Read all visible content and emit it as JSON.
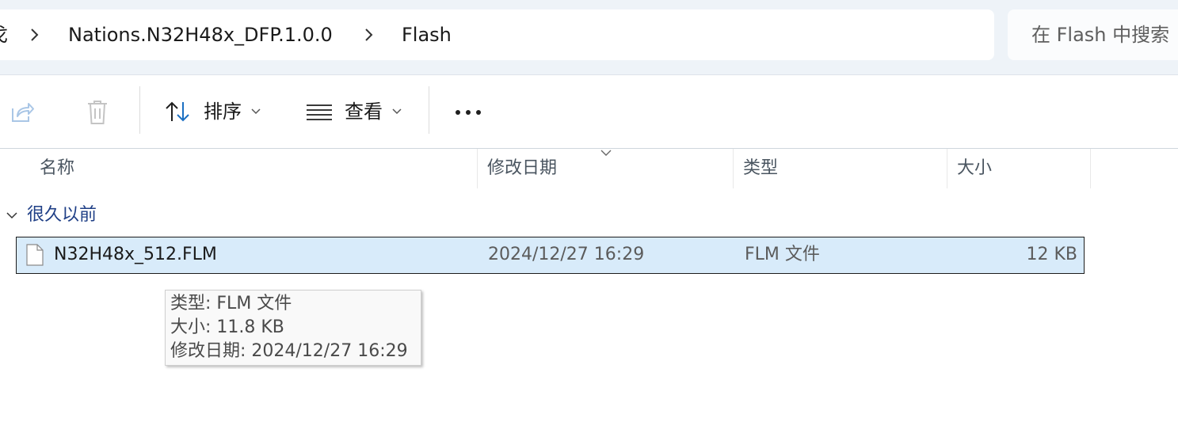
{
  "address_bar": {
    "crumbs": [
      "戈",
      "Nations.N32H48x_DFP.1.0.0",
      "Flash"
    ]
  },
  "search": {
    "placeholder": "在 Flash 中搜索"
  },
  "toolbar": {
    "share_icon": "share-icon",
    "delete_icon": "trash-icon",
    "sort_label": "排序",
    "view_label": "查看",
    "more_label": "•••"
  },
  "columns": {
    "name": "名称",
    "modified": "修改日期",
    "type": "类型",
    "size": "大小"
  },
  "group": {
    "label": "很久以前"
  },
  "files": [
    {
      "name": "N32H48x_512.FLM",
      "modified": "2024/12/27 16:29",
      "type": "FLM 文件",
      "size": "12 KB"
    }
  ],
  "tooltip": {
    "type_line": "类型: FLM 文件",
    "size_line": "大小: 11.8 KB",
    "modified_line": "修改日期: 2024/12/27 16:29"
  },
  "colors": {
    "selection": "#d8ebfa",
    "group_text": "#1f3f86",
    "topbar": "#eef3f8"
  }
}
